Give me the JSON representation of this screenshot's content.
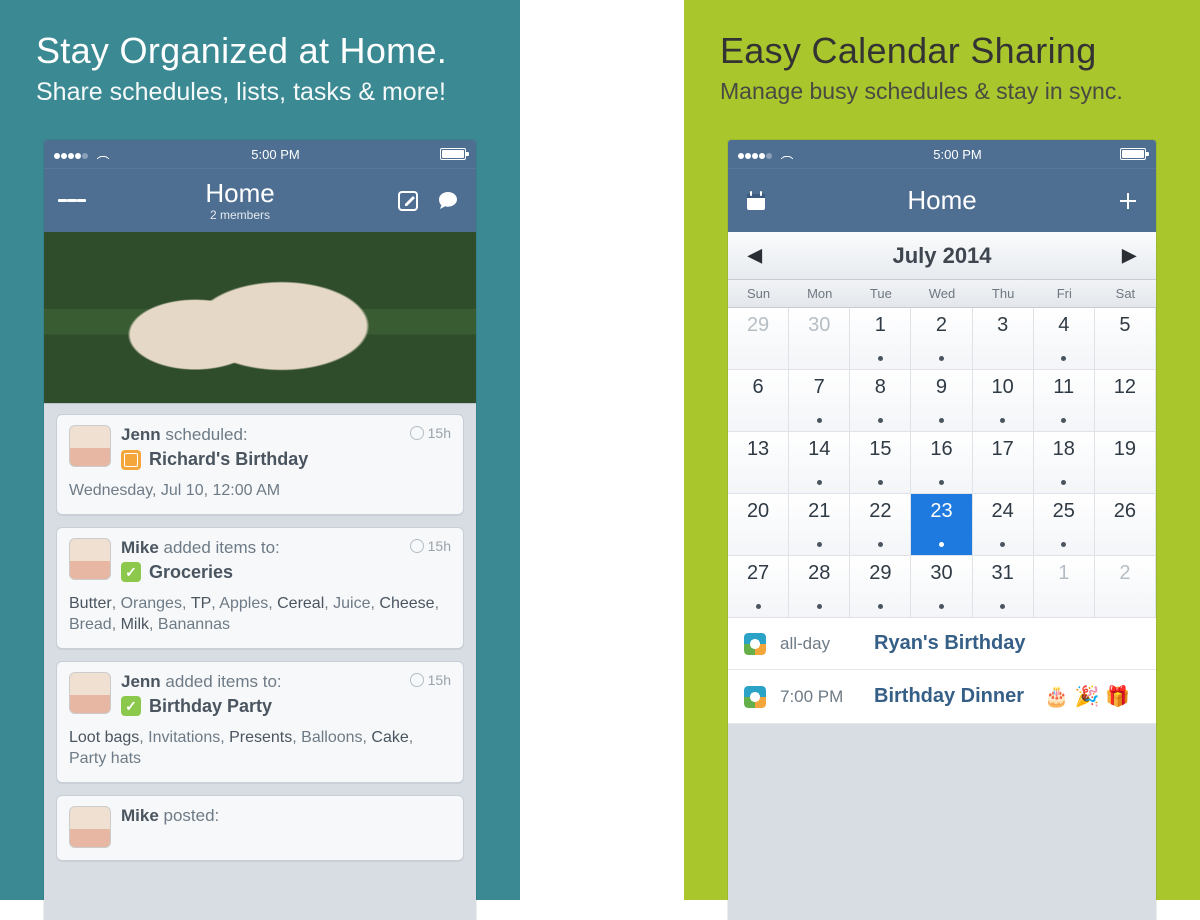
{
  "left": {
    "headline": "Stay Organized at Home.",
    "subhead": "Share schedules, lists, tasks & more!",
    "status": {
      "time": "5:00 PM"
    },
    "nav": {
      "title": "Home",
      "subtitle": "2 members"
    },
    "feed": [
      {
        "author": "Jenn",
        "verb": "scheduled:",
        "icon": "cal",
        "title": "Richard's Birthday",
        "time": "15h",
        "body_plain": "Wednesday, Jul 10, 12:00 AM",
        "body_html": "Wednesday, Jul 10, 12:00 AM"
      },
      {
        "author": "Mike",
        "verb": "added items to:",
        "icon": "list",
        "title": "Groceries",
        "time": "15h",
        "body_plain": "Butter, Oranges, TP, Apples, Cereal, Juice, Cheese, Bread, Milk, Banannas",
        "body_html": "<span class='hl'>Butter</span>, Oranges, <span class='hl'>TP</span>, Apples, <span class='hl'>Cereal</span>, Juice, <span class='hl'>Cheese</span>, Bread, <span class='hl'>Milk</span>, Banannas"
      },
      {
        "author": "Jenn",
        "verb": "added items to:",
        "icon": "list",
        "title": "Birthday Party",
        "time": "15h",
        "body_plain": "Loot bags, Invitations, Presents, Balloons, Cake, Party hats",
        "body_html": "<span class='hl'>Loot bags</span>, Invitations, <span class='hl'>Presents</span>, Balloons, <span class='hl'>Cake</span>, Party hats"
      },
      {
        "author": "Mike",
        "verb": "posted:",
        "icon": "",
        "title": "",
        "time": "",
        "body_plain": "",
        "body_html": ""
      }
    ]
  },
  "right": {
    "headline": "Easy Calendar Sharing",
    "subhead": "Manage busy schedules & stay in sync.",
    "status": {
      "time": "5:00 PM"
    },
    "nav": {
      "title": "Home"
    },
    "month": "July 2014",
    "dow": [
      "Sun",
      "Mon",
      "Tue",
      "Wed",
      "Thu",
      "Fri",
      "Sat"
    ],
    "days": [
      {
        "n": 29,
        "ot": true,
        "dot": false
      },
      {
        "n": 30,
        "ot": true,
        "dot": false
      },
      {
        "n": 1,
        "dot": true
      },
      {
        "n": 2,
        "dot": true
      },
      {
        "n": 3,
        "dot": false
      },
      {
        "n": 4,
        "dot": true
      },
      {
        "n": 5,
        "dot": false
      },
      {
        "n": 6,
        "dot": false
      },
      {
        "n": 7,
        "dot": true
      },
      {
        "n": 8,
        "dot": true
      },
      {
        "n": 9,
        "dot": true
      },
      {
        "n": 10,
        "dot": true
      },
      {
        "n": 11,
        "dot": true
      },
      {
        "n": 12,
        "dot": false
      },
      {
        "n": 13,
        "dot": false
      },
      {
        "n": 14,
        "dot": true
      },
      {
        "n": 15,
        "dot": true
      },
      {
        "n": 16,
        "dot": true
      },
      {
        "n": 17,
        "dot": false
      },
      {
        "n": 18,
        "dot": true
      },
      {
        "n": 19,
        "dot": false
      },
      {
        "n": 20,
        "dot": false
      },
      {
        "n": 21,
        "dot": true
      },
      {
        "n": 22,
        "dot": true
      },
      {
        "n": 23,
        "dot": true,
        "sel": true
      },
      {
        "n": 24,
        "dot": true
      },
      {
        "n": 25,
        "dot": true
      },
      {
        "n": 26,
        "dot": false
      },
      {
        "n": 27,
        "dot": true
      },
      {
        "n": 28,
        "dot": true
      },
      {
        "n": 29,
        "dot": true
      },
      {
        "n": 30,
        "dot": true
      },
      {
        "n": 31,
        "dot": true
      },
      {
        "n": 1,
        "ot": true,
        "dot": false
      },
      {
        "n": 2,
        "ot": true,
        "dot": false
      }
    ],
    "events": [
      {
        "when": "all-day",
        "title": "Ryan's Birthday",
        "emoji": ""
      },
      {
        "when": "7:00 PM",
        "title": "Birthday Dinner",
        "emoji": "🎂 🎉 🎁"
      }
    ]
  }
}
